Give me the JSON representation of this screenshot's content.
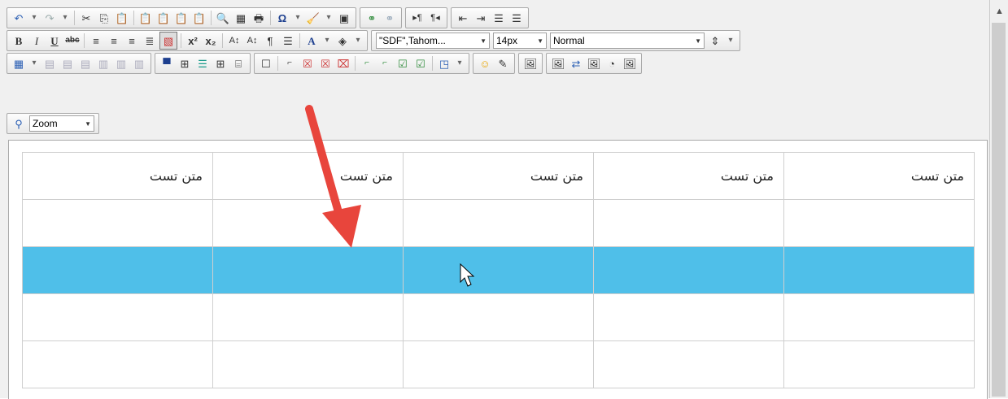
{
  "toolbar": {
    "font_family": "\"SDF\",Tahom...",
    "font_size": "14px",
    "format": "Normal",
    "zoom_label": "Zoom"
  },
  "table": {
    "header": [
      "متن تست",
      "متن تست",
      "متن تست",
      "متن تست",
      "متن تست"
    ],
    "highlight_color": "#4fbfe9"
  },
  "annotation": {
    "arrow_color": "#e8453c"
  }
}
